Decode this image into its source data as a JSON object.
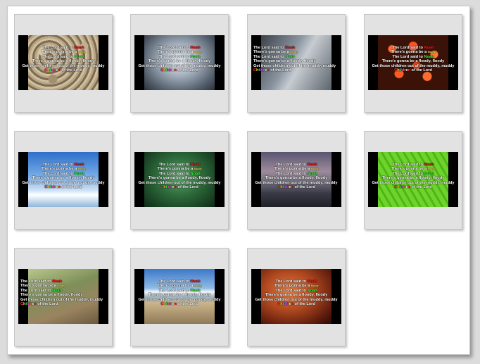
{
  "slides": [
    {
      "bg": "pebbles",
      "layout": "center",
      "line1a": "The Lord said to ",
      "noah": "Noah",
      "line2a": "There's gonna be a ",
      "small": "floody",
      "line3": "The Lord said to ",
      "line4": "There's gonna be a floody, floody",
      "line5": "Get those children out of the muddy, muddy",
      "children": [
        "C",
        "h",
        "i",
        "l",
        "d",
        "r",
        "e",
        "n"
      ],
      "line6": " of the Lord"
    },
    {
      "bg": "droplets",
      "layout": "center",
      "line1a": "The Lord said to ",
      "noah": "Noah",
      "line2a": "There's gonna be a ",
      "small": "floody",
      "line3": "The Lord said to ",
      "line4": "There's gonna be a floody, floody",
      "line5": "Get those children out of the muddy, muddy",
      "children": [
        "C",
        "h",
        "i",
        "l",
        "d",
        "r",
        "e",
        "n"
      ],
      "line6": " of the Lord"
    },
    {
      "bg": "grass",
      "layout": "left",
      "line1a": "The Lord said to ",
      "noah": "Noah",
      "line2a": "There's gonna be a ",
      "small": "floody",
      "line3": "The Lord said to ",
      "line4": "There's gonna be a floody, floody",
      "line5": "Get those children out of the muddy, muddy",
      "children": [
        "C",
        "h",
        "i",
        "l",
        "d",
        "r",
        "e",
        "n"
      ],
      "line6": " of the Lord"
    },
    {
      "bg": "flowers",
      "layout": "center",
      "line1a": "The Lord said to ",
      "noah": "Noah",
      "line2a": "There's gonna be a ",
      "small": "floody",
      "line3": "The Lord said to ",
      "line4": "There's gonna be a floody, floody",
      "line5": "Get those children out of the muddy, muddy",
      "children": [
        "C",
        "h",
        "i",
        "l",
        "d",
        "r",
        "e",
        "n"
      ],
      "line6": " of the Lord"
    },
    {
      "bg": "sky",
      "layout": "center",
      "line1a": "The Lord said to ",
      "noah": "Noah",
      "line2a": "There's gonna be a ",
      "small": "floody",
      "line3": "The Lord said to ",
      "line4": "There's gonna be a floody, floody",
      "line5": "Get those children out of the muddy, muddy",
      "children": [
        "C",
        "h",
        "i",
        "l",
        "d",
        "r",
        "e",
        "n"
      ],
      "line6": " of the Lord"
    },
    {
      "bg": "green",
      "layout": "center",
      "line1a": "The Lord said to ",
      "noah": "Noah",
      "line2a": "There's gonna be a ",
      "small": "floody",
      "line3": "The Lord said to ",
      "line4": "There's gonna be a floody, floody",
      "line5": "Get those children out of the muddy, muddy",
      "children": [
        "C",
        "h",
        "i",
        "l",
        "d",
        "r",
        "e",
        "n"
      ],
      "line6": " of the Lord"
    },
    {
      "bg": "lake",
      "layout": "center",
      "line1a": "The Lord said to ",
      "noah": "Noah",
      "line2a": "There's gonna be a ",
      "small": "floody",
      "line3": "The Lord said to ",
      "line4": "There's gonna be a floody, floody",
      "line5": "Get those children out of the muddy, muddy",
      "children": [
        "C",
        "h",
        "i",
        "l",
        "d",
        "r",
        "e",
        "n"
      ],
      "line6": " of the Lord"
    },
    {
      "bg": "leaf",
      "layout": "center",
      "line1a": "The Lord said to ",
      "noah": "Noah",
      "line2a": "There's gonna be a ",
      "small": "floody",
      "line3": "The Lord said to ",
      "line4": "There's gonna be a floody, floody",
      "line5": "Get those children out of the muddy, muddy",
      "children": [
        "C",
        "h",
        "i",
        "l",
        "d",
        "r",
        "e",
        "n"
      ],
      "line6": " of the Lord"
    },
    {
      "bg": "reeds",
      "layout": "left",
      "line1a": "The Lord said to ",
      "noah": "Noah",
      "line2a": "There's gonna be a ",
      "small": "floody",
      "line3": "The Lord said to ",
      "line4": "There's gonna be a floody, floody",
      "line5": "Get those children out of the muddy, muddy",
      "children": [
        "C",
        "h",
        "i",
        "l",
        "d",
        "r",
        "e",
        "n"
      ],
      "line6": " of the Lord"
    },
    {
      "bg": "road",
      "layout": "center",
      "line1a": "The Lord said to ",
      "noah": "Noah",
      "line2a": "There's gonna be a ",
      "small": "floody",
      "line3": "The Lord said to ",
      "line4": "There's gonna be a floody, floody",
      "line5": "Get those children out of the muddy, muddy",
      "children": [
        "C",
        "h",
        "i",
        "l",
        "d",
        "r",
        "e",
        "n"
      ],
      "line6": " of the Lord"
    },
    {
      "bg": "canyon",
      "layout": "center",
      "line1a": "The Lord said to ",
      "noah": "Noah",
      "line2a": "There's gonna be a ",
      "small": "floody",
      "line3": "The Lord said to ",
      "line4": "There's gonna be a floody, floody",
      "line5": "Get those children out of the muddy, muddy",
      "children": [
        "C",
        "h",
        "i",
        "l",
        "d",
        "r",
        "e",
        "n"
      ],
      "line6": " of the Lord"
    }
  ]
}
